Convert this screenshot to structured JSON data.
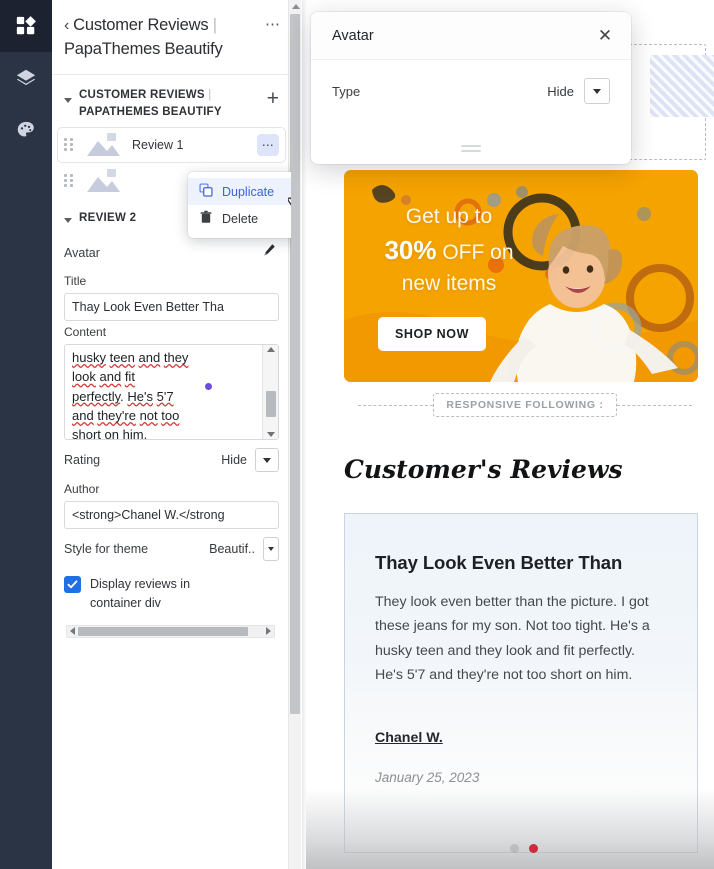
{
  "rail": {
    "items": [
      {
        "name": "blocks-icon",
        "active": true
      },
      {
        "name": "layers-icon",
        "active": false
      },
      {
        "name": "palette-icon",
        "active": false
      }
    ]
  },
  "sidebar": {
    "header": {
      "back_chevron": "‹",
      "title_part1": "Customer Reviews",
      "separator": " | ",
      "title_part2": "PapaThemes Beautify",
      "menu_dots": "⋯"
    },
    "section": {
      "label_line1": "CUSTOMER REVIEWS",
      "separator": " | ",
      "label_line2": "PAPATHEMES BEAUTIFY",
      "add_label": "+"
    },
    "items": [
      {
        "label": "Review 1",
        "menu_dots": "⋯"
      },
      {
        "label": "",
        "menu_dots": ""
      }
    ],
    "context_menu": {
      "items": [
        {
          "label": "Duplicate",
          "icon": "duplicate-icon",
          "highlighted": true
        },
        {
          "label": "Delete",
          "icon": "trash-icon",
          "highlighted": false
        }
      ]
    },
    "panel": {
      "title": "REVIEW 2",
      "prev": "‹",
      "next": "›",
      "avatar_label": "Avatar",
      "title_label": "Title",
      "title_value": "Thay Look Even Better Tha",
      "content_label": "Content",
      "content_value": "husky teen and they\nlook and fit\nperfectly. He's 5'7\nand they're not too\nshort on him.",
      "rating_label": "Rating",
      "rating_value": "Hide",
      "author_label": "Author",
      "author_value": "<strong>Chanel W.</strong",
      "style_label": "Style for theme",
      "style_value": "Beautif..",
      "checkbox_label": "Display reviews in container div",
      "checkbox_checked": true
    }
  },
  "modal": {
    "title": "Avatar",
    "close": "✕",
    "type_label": "Type",
    "type_value": "Hide"
  },
  "canvas": {
    "hero": {
      "line1": "Get up to",
      "percent": "30%",
      "line2_rest": " OFF on",
      "line3": "new items",
      "button": "SHOP NOW"
    },
    "responsive_tag": "RESPONSIVE FOLLOWING :",
    "section_heading": "Customer's Reviews",
    "review": {
      "title": "Thay Look Even Better Than",
      "body": "They look even better than the picture. I got these jeans for my son. Not too tight. He's a husky teen and they look and fit perfectly. He's 5'7 and they're not too short on him.",
      "author": "Chanel W.",
      "date": "January 25, 2023"
    }
  },
  "colors": {
    "rail_bg": "#2b3445",
    "rail_active": "#1c2230",
    "accent_blue": "#1f6fe5",
    "menu_highlight": "#3b64d8",
    "hero_orange": "#f5a301",
    "dot_red": "#cc2b3c",
    "caret_purple": "#6a4ce0"
  }
}
